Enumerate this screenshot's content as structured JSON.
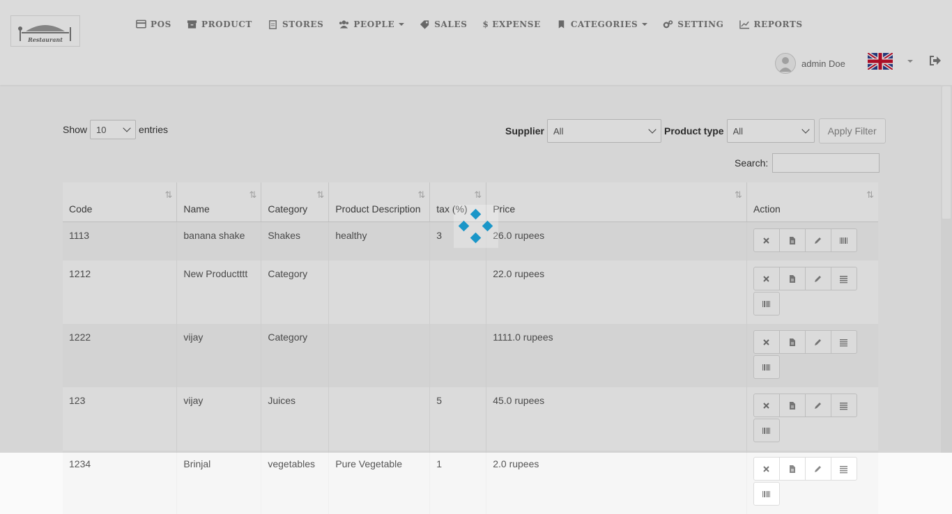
{
  "header": {
    "logo_text": "Restaurant",
    "nav": [
      {
        "label": "POS",
        "icon": "credit-card-icon"
      },
      {
        "label": "PRODUCT",
        "icon": "archive-icon"
      },
      {
        "label": "STORES",
        "icon": "clipboard-icon"
      },
      {
        "label": "PEOPLE",
        "icon": "users-icon",
        "dropdown": true
      },
      {
        "label": "SALES",
        "icon": "tag-icon"
      },
      {
        "label": "$ EXPENSE",
        "icon": "dollar-icon"
      },
      {
        "label": "CATEGORIES",
        "icon": "bookmark-icon",
        "dropdown": true
      },
      {
        "label": "SETTING",
        "icon": "gears-icon"
      },
      {
        "label": "REPORTS",
        "icon": "line-chart-icon"
      }
    ],
    "user_name": "admin Doe",
    "language_icon": "uk-flag-icon"
  },
  "controls": {
    "show_label": "Show",
    "entries_value": "10",
    "entries_label": "entries",
    "supplier_label": "Supplier",
    "supplier_value": "All",
    "product_type_label": "Product type",
    "product_type_value": "All",
    "apply_filter": "Apply Filter",
    "search_label": "Search:"
  },
  "table": {
    "headers": [
      "Code",
      "Name",
      "Category",
      "Product Description",
      "tax (%)",
      "Price",
      "Action"
    ],
    "rows": [
      {
        "code": "1113",
        "name": "banana shake",
        "category": "Shakes",
        "description": "healthy",
        "tax": "3",
        "price": "26.0 rupees"
      },
      {
        "code": "1212",
        "name": "New Productttt",
        "category": "Category",
        "description": "",
        "tax": "",
        "price": "22.0 rupees"
      },
      {
        "code": "1222",
        "name": "vijay",
        "category": "Category",
        "description": "",
        "tax": "",
        "price": "1111.0 rupees"
      },
      {
        "code": "123",
        "name": "vijay",
        "category": "Juices",
        "description": "",
        "tax": "5",
        "price": "45.0 rupees"
      },
      {
        "code": "1234",
        "name": "Brinjal",
        "category": "vegetables",
        "description": "Pure Vegetable",
        "tax": "1",
        "price": "2.0 rupees"
      }
    ]
  },
  "colors": {
    "spinner": "#1a96c8",
    "overlay": "rgba(0,0,0,0.14)"
  }
}
